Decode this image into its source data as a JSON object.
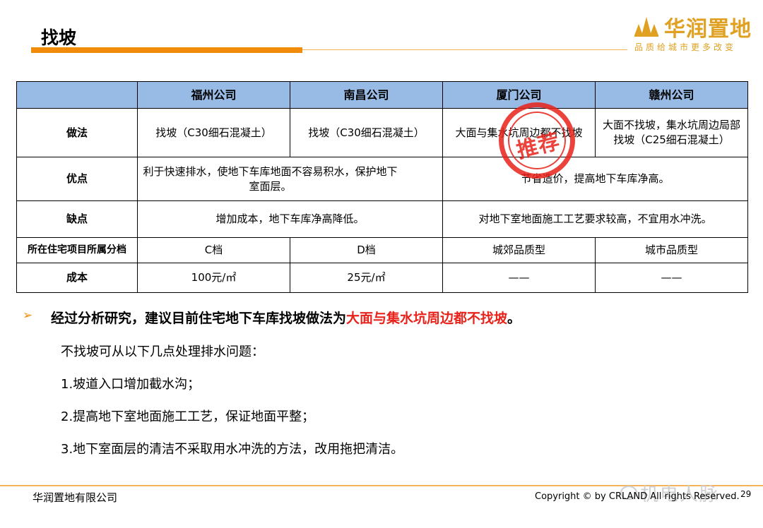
{
  "page": {
    "title": "找坡"
  },
  "logo": {
    "name": "华润置地",
    "slogan": "品质给城市更多改变"
  },
  "table": {
    "headers": [
      "",
      "福州公司",
      "南昌公司",
      "厦门公司",
      "赣州公司"
    ],
    "method": {
      "label": "做法",
      "fuzhou": "找坡（C30细石混凝土）",
      "nanchang": "找坡（C30细石混凝土）",
      "xiamen": "大面与集水坑周边都不找坡",
      "ganzhou": "大面不找坡，集水坑周边局部找坡（C25细石混凝土）"
    },
    "advantages": {
      "label": "优点",
      "left": "利于快速排水，使地下车库地面不容易积水，保护地下室面层。",
      "right": "节省造价，提高地下车库净高。"
    },
    "disadvantages": {
      "label": "缺点",
      "left": "增加成本，地下车库净高降低。",
      "right": "对地下室地面施工工艺要求较高，不宜用水冲洗。"
    },
    "grade": {
      "label": "所在住宅项目所属分档",
      "fuzhou": "C档",
      "nanchang": "D档",
      "xiamen": "城郊品质型",
      "ganzhou": "城市品质型"
    },
    "cost": {
      "label": "成本",
      "fuzhou": "100元/㎡",
      "nanchang": "25元/㎡",
      "xiamen": "——",
      "ganzhou": "——"
    }
  },
  "stamp": {
    "text": "推荐",
    "color": "#e8231b"
  },
  "conclusion": {
    "bullet": "➢",
    "prefix": "经过分析研究，建议目前住宅地下车库找坡做法为",
    "highlight": "大面与集水坑周边都不找坡",
    "suffix": "。"
  },
  "body": {
    "intro": "不找坡可从以下几点处理排水问题：",
    "items": [
      "1.坡道入口增加截水沟；",
      "2.提高地下室地面施工工艺，保证地面平整；",
      "3.地下室面层的清洁不采取用水冲洗的方法，改用拖把清洁。"
    ]
  },
  "footer": {
    "company": "华润置地有限公司",
    "copyright": "Copyright © by CRLAND  All rights Reserved.",
    "page_number": "29",
    "watermark": "机电人脉"
  },
  "colors": {
    "accent": "#f08c0a",
    "header_fill": "#98bbe6",
    "highlight": "#e8231b",
    "logo": "#e0a022"
  }
}
